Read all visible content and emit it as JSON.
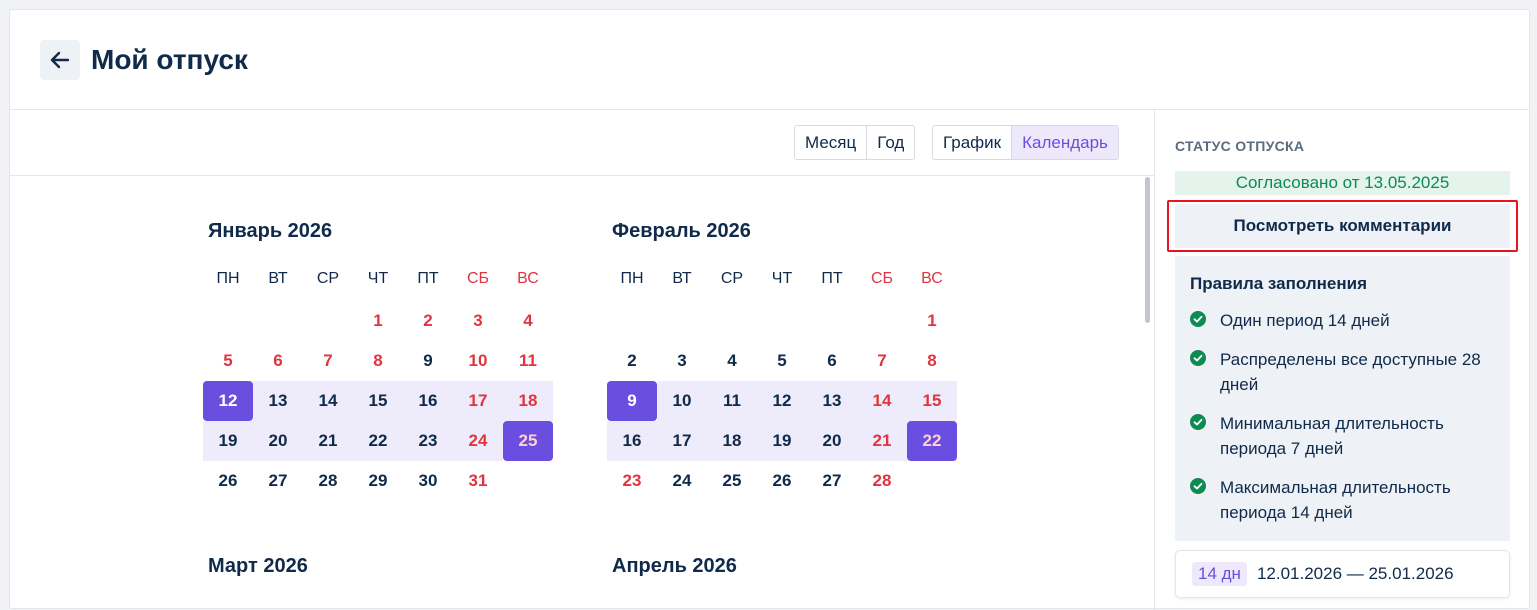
{
  "header": {
    "title": "Мой отпуск"
  },
  "toolbar": {
    "period_toggle": [
      {
        "label": "Месяц",
        "active": false
      },
      {
        "label": "Год",
        "active": false
      }
    ],
    "view_toggle": [
      {
        "label": "График",
        "active": false
      },
      {
        "label": "Календарь",
        "active": true
      }
    ]
  },
  "calendar": {
    "weekdays": [
      "ПН",
      "ВТ",
      "СР",
      "ЧТ",
      "ПТ",
      "СБ",
      "ВС"
    ],
    "months": [
      {
        "title": "Январь 2026",
        "weeks": [
          [
            "",
            "",
            "",
            "1",
            "2",
            "3",
            "4"
          ],
          [
            "5",
            "6",
            "7",
            "8",
            "9",
            "10",
            "11"
          ],
          [
            "12",
            "13",
            "14",
            "15",
            "16",
            "17",
            "18"
          ],
          [
            "19",
            "20",
            "21",
            "22",
            "23",
            "24",
            "25"
          ],
          [
            "26",
            "27",
            "28",
            "29",
            "30",
            "31",
            ""
          ]
        ],
        "holidays": [
          "1",
          "2",
          "3",
          "4",
          "5",
          "6",
          "7",
          "8",
          "10",
          "11",
          "17",
          "18",
          "24",
          "25",
          "31"
        ],
        "selected": [
          "12",
          "13",
          "14",
          "15",
          "16",
          "17",
          "18",
          "19",
          "20",
          "21",
          "22",
          "23",
          "24",
          "25"
        ],
        "range_ends": [
          "12",
          "25"
        ]
      },
      {
        "title": "Февраль 2026",
        "weeks": [
          [
            "",
            "",
            "",
            "",
            "",
            "",
            "1"
          ],
          [
            "2",
            "3",
            "4",
            "5",
            "6",
            "7",
            "8"
          ],
          [
            "9",
            "10",
            "11",
            "12",
            "13",
            "14",
            "15"
          ],
          [
            "16",
            "17",
            "18",
            "19",
            "20",
            "21",
            "22"
          ],
          [
            "23",
            "24",
            "25",
            "26",
            "27",
            "28",
            ""
          ]
        ],
        "holidays": [
          "1",
          "7",
          "8",
          "14",
          "15",
          "21",
          "22",
          "23",
          "28"
        ],
        "selected": [
          "9",
          "10",
          "11",
          "12",
          "13",
          "14",
          "15",
          "16",
          "17",
          "18",
          "19",
          "20",
          "21",
          "22"
        ],
        "range_ends": [
          "9",
          "22"
        ]
      },
      {
        "title": "Март 2026",
        "weeks": [],
        "holidays": [],
        "selected": [],
        "range_ends": []
      },
      {
        "title": "Апрель 2026",
        "weeks": [],
        "holidays": [],
        "selected": [],
        "range_ends": []
      }
    ]
  },
  "sidebar": {
    "status_label": "СТАТУС ОТПУСКА",
    "status": "Согласовано от 13.05.2025",
    "comments_button": "Посмотреть комментарии",
    "rules_title": "Правила заполнения",
    "rules": [
      "Один период 14 дней",
      "Распределены все доступные 28 дней",
      "Минимальная длительность периода 7 дней",
      "Максимальная длительность периода 14 дней"
    ],
    "period": {
      "days": "14 дн",
      "range": "12.01.2026 — 25.01.2026"
    }
  },
  "colors": {
    "accent": "#6a4ee0",
    "accent_light": "#eeebfb",
    "weekend": "#e0353f",
    "success": "#0e8a53",
    "highlight_border": "#e8141e"
  }
}
